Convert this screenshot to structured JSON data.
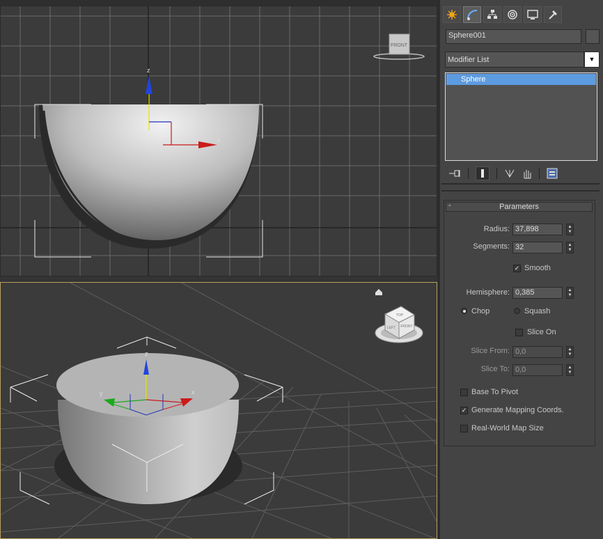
{
  "object_name": "Sphere001",
  "modifier_list": {
    "label": "Modifier List",
    "arrow": "▼"
  },
  "stack": {
    "items": [
      "Sphere"
    ]
  },
  "viewcube_front_label": "FRONT",
  "viewcube_persp_faces": [
    "TOP",
    "LEFT",
    "FRONT"
  ],
  "axis_labels": {
    "x": "x",
    "y": "y",
    "z": "z"
  },
  "parameters": {
    "title": "Parameters",
    "collapse": "-",
    "radius_label": "Radius:",
    "radius_value": "37,898",
    "segments_label": "Segments:",
    "segments_value": "32",
    "smooth_label": "Smooth",
    "smooth_checked": true,
    "hemisphere_label": "Hemisphere:",
    "hemisphere_value": "0,385",
    "chop_label": "Chop",
    "squash_label": "Squash",
    "chop_selected": true,
    "slice_on_label": "Slice On",
    "slice_from_label": "Slice From:",
    "slice_from_value": "0,0",
    "slice_to_label": "Slice To:",
    "slice_to_value": "0,0",
    "base_to_pivot_label": "Base To Pivot",
    "gen_mapping_label": "Generate Mapping Coords.",
    "gen_mapping_checked": true,
    "real_world_label": "Real-World Map Size"
  },
  "tabs": [
    "create-icon",
    "modify-icon",
    "hierarchy-icon",
    "motion-icon",
    "display-icon",
    "utilities-icon"
  ],
  "stack_tools": [
    "pin-stack-icon",
    "show-end-result-icon",
    "make-unique-icon",
    "remove-modifier-icon",
    "configure-sets-icon"
  ],
  "colors": {
    "selection": "#5d9be0",
    "active_viewport_border": "#b8a060",
    "x_axis": "#cc1a1a",
    "y_axis": "#1aaa1a",
    "z_axis": "#1a3acc"
  }
}
